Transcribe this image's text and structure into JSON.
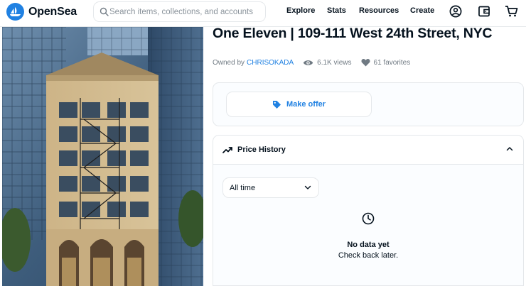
{
  "header": {
    "brand": "OpenSea",
    "search_placeholder": "Search items, collections, and accounts",
    "nav": [
      "Explore",
      "Stats",
      "Resources",
      "Create"
    ]
  },
  "item": {
    "title": "One Eleven | 109-111 West 24th Street, NYC",
    "owned_by_label": "Owned by",
    "owner": "CHRISOKADA",
    "views": "6.1K views",
    "favorites": "61 favorites"
  },
  "offer": {
    "button_label": "Make offer"
  },
  "price_history": {
    "title": "Price History",
    "range_selected": "All time",
    "empty_title": "No data yet",
    "empty_subtitle": "Check back later."
  },
  "colors": {
    "accent": "#2081e2",
    "text": "#04111d",
    "muted": "#707a83",
    "border": "#e5e8eb"
  },
  "icons": [
    "opensea-logo-icon",
    "search-icon",
    "account-icon",
    "wallet-icon",
    "cart-icon",
    "eye-icon",
    "heart-icon",
    "tag-icon",
    "trending-icon",
    "chevron-up-icon",
    "chevron-down-icon",
    "clock-icon"
  ]
}
